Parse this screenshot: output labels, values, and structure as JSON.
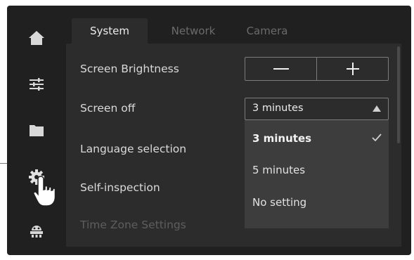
{
  "tabs": [
    {
      "label": "System",
      "active": true
    },
    {
      "label": "Network",
      "active": false
    },
    {
      "label": "Camera",
      "active": false
    }
  ],
  "nav": [
    {
      "icon": "home-icon"
    },
    {
      "icon": "sliders-icon"
    },
    {
      "icon": "folder-icon"
    },
    {
      "icon": "gear-icon",
      "active": true
    },
    {
      "icon": "robot-icon"
    }
  ],
  "settings": {
    "brightness": {
      "label": "Screen Brightness",
      "decrease": "—",
      "increase": "+"
    },
    "screen_off": {
      "label": "Screen off",
      "value": "3 minutes",
      "options": [
        {
          "label": "3 minutes",
          "selected": true
        },
        {
          "label": "5 minutes",
          "selected": false
        },
        {
          "label": "No setting",
          "selected": false
        }
      ]
    },
    "language": {
      "label": "Language selection"
    },
    "self_inspection": {
      "label": "Self-inspection"
    },
    "time_zone": {
      "label": "Time Zone Settings"
    }
  },
  "colors": {
    "background": "#202020",
    "panel": "#2c2c2c",
    "dropdown": "#3d3d3d",
    "text": "#dadada",
    "inactive_tab": "#6b6b6b",
    "border": "#7c7c7c"
  },
  "icons": {
    "caret": "caret-up-icon",
    "check": "check-icon",
    "cursor": "hand-pointer-icon"
  }
}
